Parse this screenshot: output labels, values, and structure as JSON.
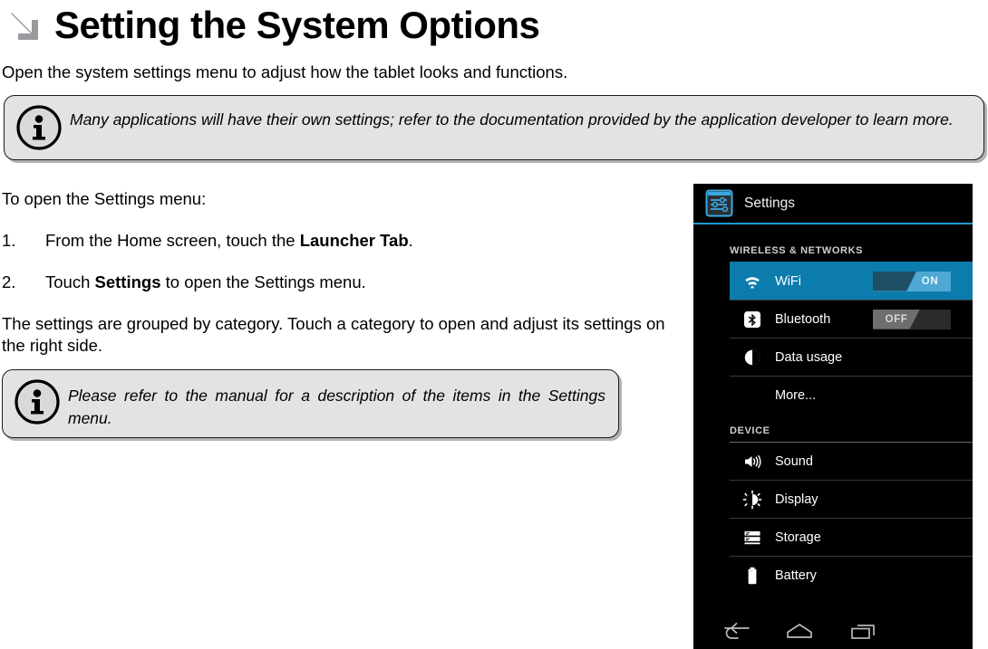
{
  "page": {
    "title": "Setting the System Options",
    "title_icon": "arrow-down-right-icon",
    "intro": "Open the system settings menu to adjust how the tablet looks and functions."
  },
  "notes": [
    {
      "icon": "info-icon",
      "text": "Many applications will have their own settings; refer to the documentation provided by the application developer to learn more."
    },
    {
      "icon": "info-icon",
      "text": "Please refer to the manual for a description of the items in the Settings menu."
    }
  ],
  "body": {
    "lead": "To open the Settings menu:",
    "steps": [
      {
        "number": "1.",
        "text_before": "From the Home screen, touch the ",
        "bold": "Launcher Tab",
        "text_after": "."
      },
      {
        "number": "2.",
        "text_before": "Touch ",
        "bold": "Settings",
        "text_after": " to open the Settings menu."
      }
    ],
    "closing": "The settings are grouped by category. Touch a category to open and adjust its settings on the right side."
  },
  "android": {
    "header": {
      "title": "Settings",
      "icon": "settings-sliders-icon"
    },
    "sections": [
      {
        "label": "WIRELESS & NETWORKS",
        "rows": [
          {
            "label": "WiFi",
            "icon": "wifi-icon",
            "toggle": "ON",
            "selected": true
          },
          {
            "label": "Bluetooth",
            "icon": "bluetooth-icon",
            "toggle": "OFF",
            "selected": false
          },
          {
            "label": "Data usage",
            "icon": "data-usage-icon",
            "toggle": null,
            "selected": false
          },
          {
            "label": "More...",
            "icon": null,
            "toggle": null,
            "selected": false
          }
        ]
      },
      {
        "label": "DEVICE",
        "rows": [
          {
            "label": "Sound",
            "icon": "sound-icon",
            "toggle": null,
            "selected": false
          },
          {
            "label": "Display",
            "icon": "display-icon",
            "toggle": null,
            "selected": false
          },
          {
            "label": "Storage",
            "icon": "storage-icon",
            "toggle": null,
            "selected": false
          },
          {
            "label": "Battery",
            "icon": "battery-icon",
            "toggle": null,
            "selected": false
          }
        ]
      }
    ],
    "navbar": [
      {
        "name": "back-icon"
      },
      {
        "name": "home-icon"
      },
      {
        "name": "recent-apps-icon"
      }
    ],
    "colors": {
      "accent": "#0c7cad",
      "header_rule": "#1b9ad1",
      "background": "#000000"
    }
  }
}
